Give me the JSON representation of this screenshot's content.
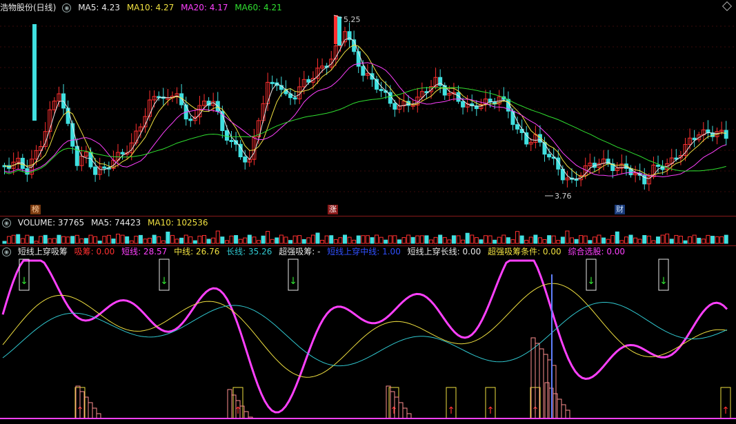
{
  "price_panel": {
    "title": "浩物股份(日线)",
    "ma_labels": [
      {
        "text": "MA5: 4.23",
        "color": "#e8e8e8"
      },
      {
        "text": "MA10: 4.27",
        "color": "#f0e040"
      },
      {
        "text": "MA20: 4.17",
        "color": "#ff40ff"
      },
      {
        "text": "MA60: 4.21",
        "color": "#30e030"
      }
    ],
    "high_label": "5.25",
    "low_label": "3.76",
    "event_marks": [
      {
        "text": "榜",
        "bg": "#7a3a10",
        "fg": "#ffd0a0"
      },
      {
        "text": "涨",
        "bg": "#8a1a1a",
        "fg": "#ffffff"
      },
      {
        "text": "财",
        "bg": "#1a3a7a",
        "fg": "#d0e8ff"
      }
    ]
  },
  "volume_panel": {
    "labels": [
      {
        "text": "VOLUME: 37765",
        "color": "#e8e8e8"
      },
      {
        "text": "MA5: 74423",
        "color": "#e8e8e8"
      },
      {
        "text": "MA10: 102536",
        "color": "#f0e040"
      }
    ]
  },
  "indicator_panel": {
    "labels": [
      {
        "text": "短线上穿吸筹",
        "color": "#e8e8e8"
      },
      {
        "text": "吸筹: 0.00",
        "color": "#ff3030"
      },
      {
        "text": "短线: 28.57",
        "color": "#ff40ff"
      },
      {
        "text": "中线: 26.76",
        "color": "#f0e040"
      },
      {
        "text": "长线: 35.26",
        "color": "#30c8d0"
      },
      {
        "text": "超强吸筹: -",
        "color": "#e8e8e8"
      },
      {
        "text": "短线上穿中线: 1.00",
        "color": "#3050ff"
      },
      {
        "text": "短线上穿长线: 0.00",
        "color": "#e8e8e8"
      },
      {
        "text": "超强吸筹条件: 0.00",
        "color": "#f0e040"
      },
      {
        "text": "综合选股: 0.00",
        "color": "#ff40ff"
      }
    ]
  },
  "colors": {
    "up": "#ff3030",
    "down": "#40e0e0",
    "ma5": "#e8e8e8",
    "ma10": "#f0e040",
    "ma20": "#ff40ff",
    "ma60": "#30e030"
  }
}
